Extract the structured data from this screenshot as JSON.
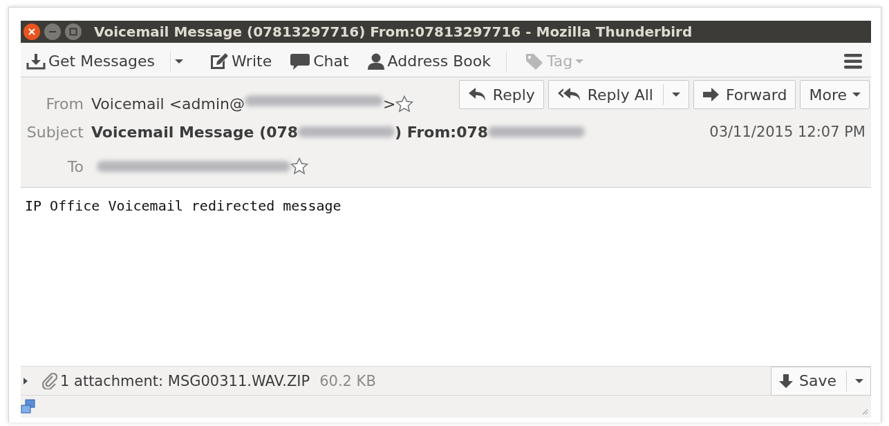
{
  "window": {
    "title": "Voicemail Message (07813297716) From:07813297716 - Mozilla Thunderbird"
  },
  "toolbar": {
    "items": [
      {
        "label": "Get Messages",
        "split": true,
        "disabled": false
      },
      {
        "label": "Write",
        "split": false,
        "disabled": false
      },
      {
        "label": "Chat",
        "split": false,
        "disabled": false
      },
      {
        "label": "Address Book",
        "split": false,
        "disabled": false
      },
      {
        "label": "Tag",
        "split": false,
        "disabled": true
      }
    ]
  },
  "header": {
    "from": {
      "label": "From",
      "segments": [
        {
          "kind": "text",
          "text": "Voicemail <admin@"
        },
        {
          "kind": "redacted"
        },
        {
          "kind": "text",
          "text": ">"
        }
      ]
    },
    "subject": {
      "label": "Subject",
      "segments": [
        {
          "kind": "text",
          "text": "Voicemail Message (078"
        },
        {
          "kind": "redacted"
        },
        {
          "kind": "text",
          "text": ") From:078"
        },
        {
          "kind": "redacted"
        }
      ]
    },
    "to": {
      "label": "To",
      "segments": [
        {
          "kind": "redacted"
        }
      ]
    },
    "date": "03/11/2015 12:07 PM",
    "actions": [
      {
        "label": "Reply",
        "kind": "reply"
      },
      {
        "label": "Reply All",
        "kind": "reply-all"
      },
      {
        "label": "Forward",
        "kind": "forward"
      },
      {
        "label": "More",
        "kind": "more"
      }
    ]
  },
  "body": "IP Office Voicemail redirected message",
  "attachments": {
    "expanded": false,
    "summary": "1 attachment: MSG00311.WAV.ZIP",
    "size": "60.2 KB",
    "save": "Save"
  }
}
